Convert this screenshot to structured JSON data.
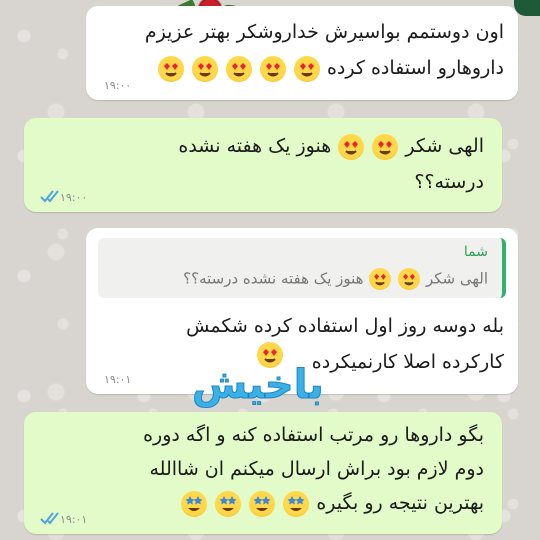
{
  "messages": [
    {
      "type": "incoming",
      "lines": [
        "اون دوستمم بواسیرش خداروشکر بهتر عزیزم",
        "داروهارو استفاده کرده"
      ],
      "emoji": "heart-eyes",
      "emoji_count": 5,
      "time": "۱۹:۰۰"
    },
    {
      "type": "outgoing",
      "lines": [
        "الهی شکر",
        "هنوز یک هفته نشده",
        "درسته؟؟"
      ],
      "emoji": "heart-eyes",
      "emoji_count": 2,
      "time": "۱۹:۰۰",
      "status": "read"
    },
    {
      "type": "incoming",
      "quote": {
        "sender": "شما",
        "text_a": "الهی شکر",
        "text_b": "هنوز یک هفته نشده درسته؟؟"
      },
      "lines": [
        "بله دوسه روز اول استفاده کرده شکمش",
        "کارکرده اصلا کارنمیکرده"
      ],
      "emoji": "heart-eyes",
      "time": "۱۹:۰۱"
    },
    {
      "type": "outgoing",
      "lines": [
        "بگو داروها رو مرتب استفاده کنه و اگه دوره",
        "دوم لازم بود براش ارسال میکنم ان شاالله",
        "بهترین نتیجه رو بگیره"
      ],
      "emoji": "star-struck",
      "emoji_count": 4,
      "time": "۱۹:۰۱",
      "status": "read"
    }
  ],
  "watermark": "باخیش",
  "colors": {
    "incoming_bg": "#ffffff",
    "outgoing_bg": "#e2fbc9",
    "read_tick": "#4fa3e0",
    "quote_accent": "#35b06b"
  }
}
